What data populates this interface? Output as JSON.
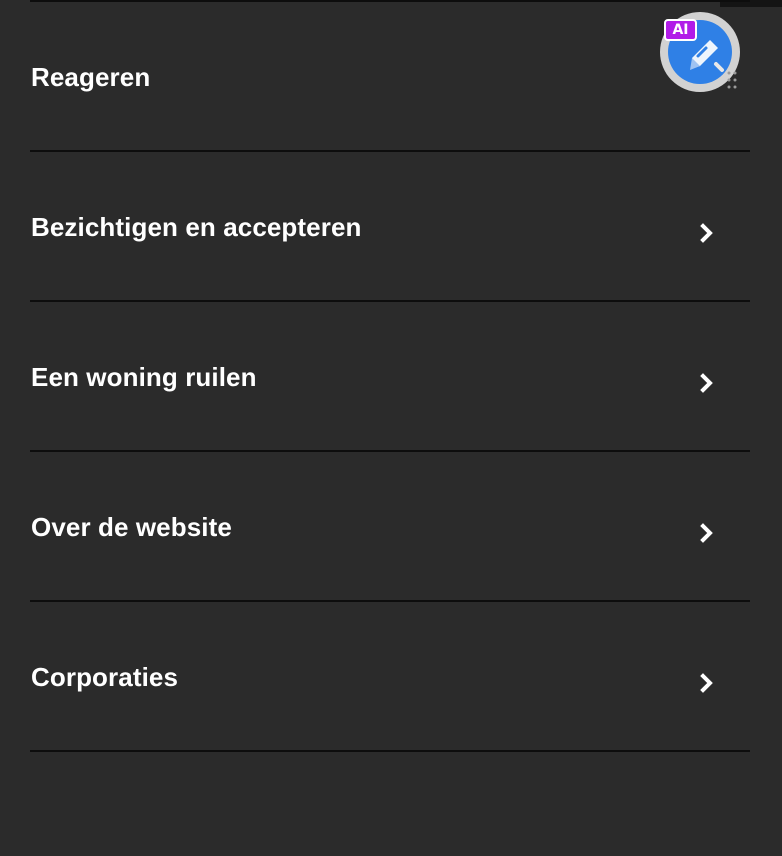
{
  "menu": {
    "items": [
      {
        "label": "Reageren",
        "has_chevron": false
      },
      {
        "label": "Bezichtigen en accepteren",
        "has_chevron": true
      },
      {
        "label": "Een woning ruilen",
        "has_chevron": true
      },
      {
        "label": "Over de website",
        "has_chevron": true
      },
      {
        "label": "Corporaties",
        "has_chevron": true
      }
    ],
    "chevron_icon": "chevron-right-icon"
  },
  "ai_assistant": {
    "badge_label": "AI",
    "icon": "ai-assistant-icon",
    "accent_color": "#2f80e6",
    "badge_color": "#b11be8"
  },
  "colors": {
    "background": "#2b2b2b",
    "divider": "#0d0d0d",
    "text": "#ffffff"
  }
}
